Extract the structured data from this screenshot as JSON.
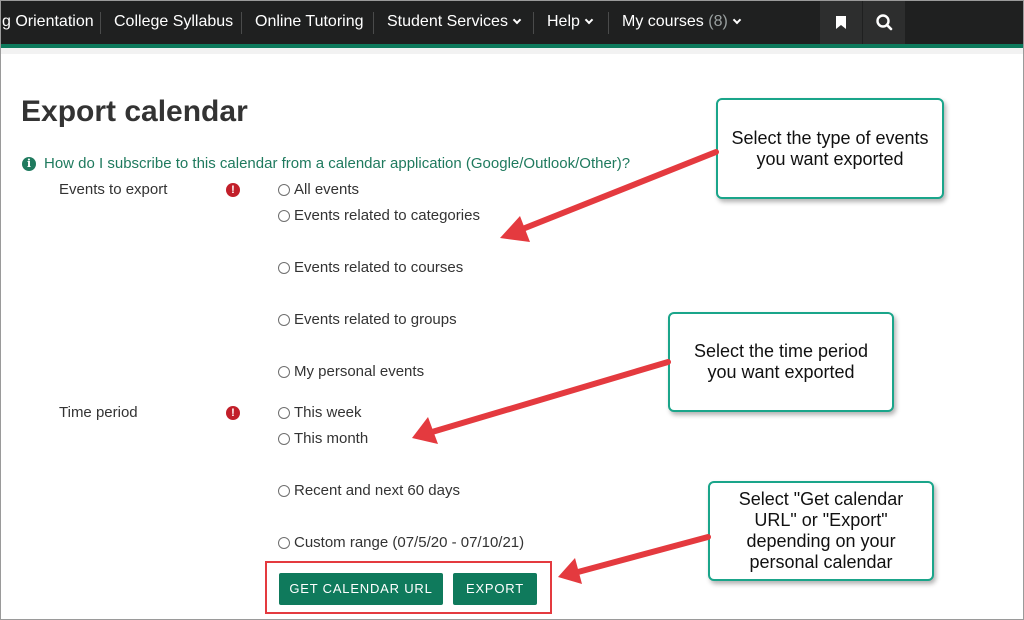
{
  "nav": {
    "items": [
      {
        "label": "g Orientation"
      },
      {
        "label": "College Syllabus"
      },
      {
        "label": "Online Tutoring"
      },
      {
        "label": "Student Services"
      },
      {
        "label": "Help"
      },
      {
        "label": "My courses",
        "count": "(8)"
      }
    ],
    "bookmark_icon": "bookmark-icon",
    "search_icon": "search-icon"
  },
  "page": {
    "title": "Export calendar",
    "help_link": "How do I subscribe to this calendar from a calendar application (Google/Outlook/Other)?"
  },
  "form": {
    "events_label": "Events to export",
    "events_options": [
      "All events",
      "Events related to categories",
      "Events related to courses",
      "Events related to groups",
      "My personal events"
    ],
    "period_label": "Time period",
    "period_options": [
      "This week",
      "This month",
      "Recent and next 60 days",
      "Custom range (07/5/20 - 07/10/21)"
    ],
    "get_url_button": "GET CALENDAR URL",
    "export_button": "EXPORT"
  },
  "callouts": {
    "events": "Select the type of events you want exported",
    "period": "Select the time period you want exported",
    "buttons": "Select \"Get calendar URL\" or \"Export\" depending on your personal calendar"
  },
  "colors": {
    "nav_bg": "#1f2020",
    "accent": "#0f7a5c",
    "required": "#c21f2a",
    "arrow": "#e43a3f",
    "callout_border": "#1aa58a"
  }
}
